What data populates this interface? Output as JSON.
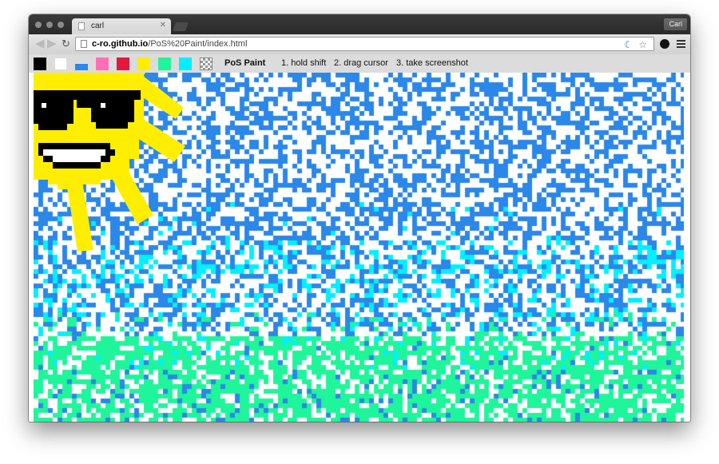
{
  "browser": {
    "tab_title": "carl",
    "profile_label": "Carl",
    "url_host": "c-ro.github.io",
    "url_path": "/PoS%20Paint/index.html"
  },
  "app": {
    "title": "PoS Paint",
    "steps": [
      "1. hold shift",
      "2. drag cursor",
      "3. take screenshot"
    ],
    "palette": [
      {
        "name": "black",
        "color": "#000000"
      },
      {
        "name": "white",
        "color": "#ffffff"
      },
      {
        "name": "blue",
        "color": "#2b87e8"
      },
      {
        "name": "pink",
        "color": "#ff6fb5"
      },
      {
        "name": "red",
        "color": "#e3173d"
      },
      {
        "name": "yellow",
        "color": "#ffee00"
      },
      {
        "name": "green",
        "color": "#1ff59a"
      },
      {
        "name": "cyan",
        "color": "#00f0ff"
      },
      {
        "name": "eraser",
        "color": "checkered"
      }
    ]
  },
  "colors": {
    "blue": "#2b87e8",
    "cyan": "#00f0ff",
    "green": "#1ff59a",
    "yellow": "#ffee00",
    "black": "#000000"
  }
}
